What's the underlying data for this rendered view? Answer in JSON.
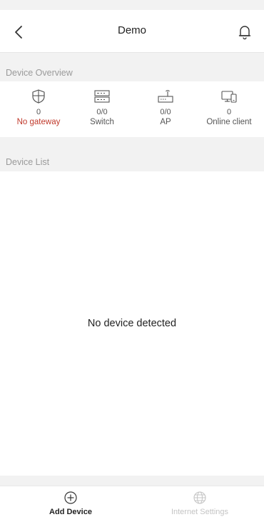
{
  "header": {
    "title": "Demo",
    "back_icon": "chevron-left-icon",
    "notification_icon": "bell-icon"
  },
  "overview": {
    "section_label": "Device Overview",
    "items": [
      {
        "icon": "gateway-shield-icon",
        "value": "0",
        "label": "No gateway",
        "label_color": "#c0392b"
      },
      {
        "icon": "switch-icon",
        "value": "0/0",
        "label": "Switch"
      },
      {
        "icon": "access-point-icon",
        "value": "0/0",
        "label": "AP"
      },
      {
        "icon": "client-devices-icon",
        "value": "0",
        "label": "Online client"
      }
    ]
  },
  "device_list": {
    "section_label": "Device List",
    "empty_message": "No device detected"
  },
  "tabbar": {
    "tabs": [
      {
        "icon": "plus-circle-icon",
        "label": "Add Device",
        "state": "active"
      },
      {
        "icon": "globe-icon",
        "label": "Internet Settings",
        "state": "disabled"
      }
    ]
  },
  "colors": {
    "background": "#f2f2f2",
    "surface": "#ffffff",
    "alert": "#c0392b",
    "muted": "#9a9a9a",
    "disabled": "#c4c4c4"
  }
}
